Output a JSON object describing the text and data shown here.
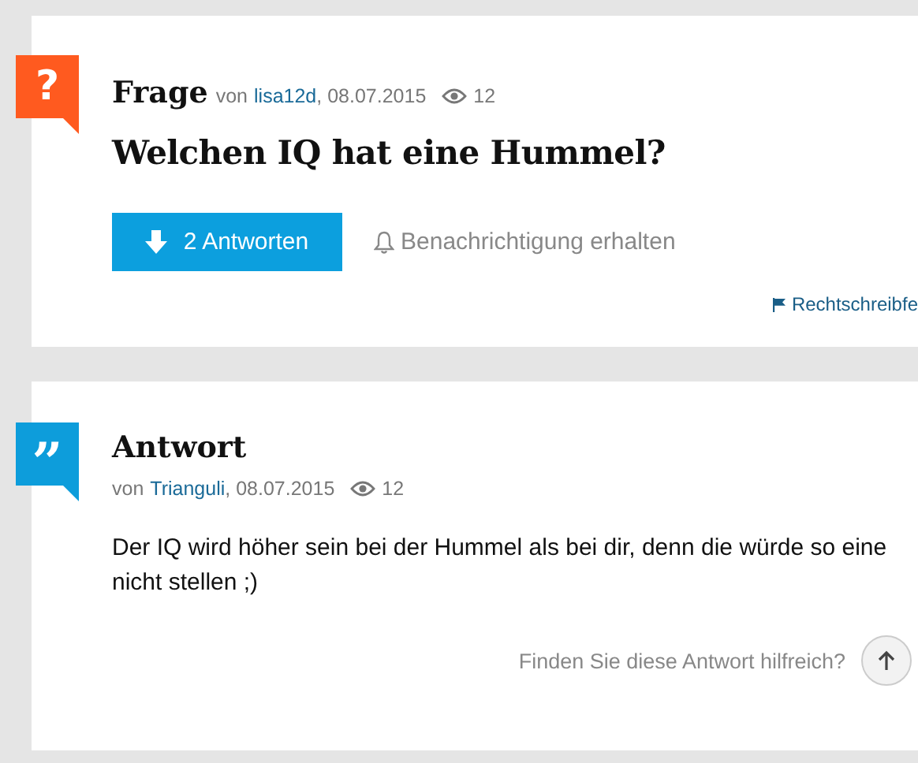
{
  "question": {
    "badge": "?",
    "label": "Frage",
    "by": "von",
    "author": "lisa12d",
    "date": ", 08.07.2015",
    "views": "12",
    "title": "Welchen IQ hat eine Hummel?",
    "answers_button": "2 Antworten",
    "notify": "Benachrichtigung erhalten",
    "report_link": "Rechtschreibfe"
  },
  "answer": {
    "badge": "”",
    "label": "Antwort",
    "by": "von",
    "author": "Trianguli",
    "date": ", 08.07.2015",
    "views": "12",
    "text": "Der IQ wird höher sein bei der Hummel als bei dir, denn die würde so eine nicht stellen ;)",
    "helpful_prompt": "Finden Sie diese Antwort hilfreich?"
  }
}
